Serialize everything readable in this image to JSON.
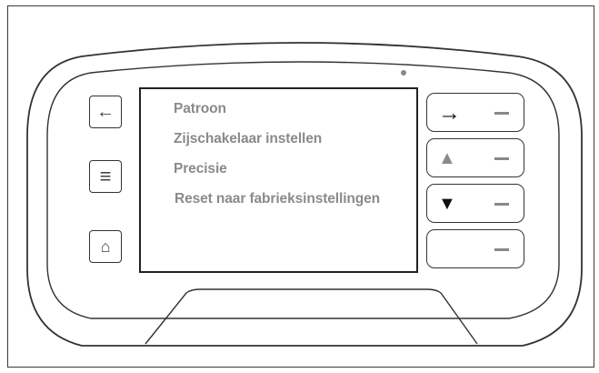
{
  "screen": {
    "menu": [
      {
        "label": "Patroon"
      },
      {
        "label": "Zijschakelaar instellen"
      },
      {
        "label": "Precisie"
      },
      {
        "label": "Reset naar fabrieksinstellingen"
      }
    ]
  },
  "left_buttons": [
    {
      "icon": "back-arrow-icon",
      "glyph": "←"
    },
    {
      "icon": "menu-icon",
      "glyph": "≡"
    },
    {
      "icon": "home-icon",
      "glyph": "⌂"
    }
  ],
  "right_buttons": [
    {
      "icon": "right-arrow-icon",
      "glyph": "→",
      "color": "#111111"
    },
    {
      "icon": "up-triangle-icon",
      "glyph": "▲",
      "color": "#8a8a8a"
    },
    {
      "icon": "down-triangle-icon",
      "glyph": "▼",
      "color": "#111111"
    },
    {
      "icon": "",
      "glyph": "",
      "color": "#111111"
    }
  ],
  "colors": {
    "outline": "#333333",
    "menu_text": "#8a8a8a",
    "dash": "#888888"
  }
}
